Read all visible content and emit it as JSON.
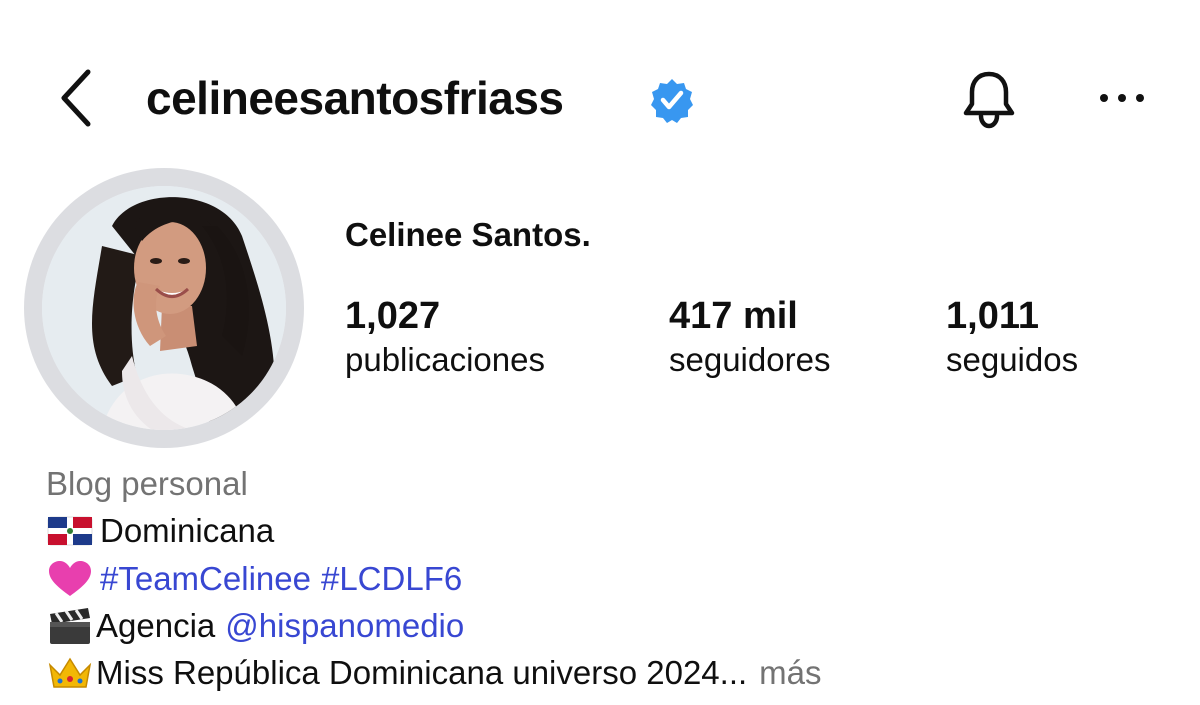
{
  "header": {
    "back_icon": "chevron-left-icon",
    "username": "celineesantosfriass",
    "verified_icon": "verified-badge-icon",
    "verified_color": "#3897f0",
    "bell_icon": "bell-icon",
    "more_icon": "more-horizontal-icon"
  },
  "profile": {
    "avatar_icon": "profile-photo",
    "display_name": "Celinee Santos.",
    "stats": [
      {
        "count": "1,027",
        "label": "publicaciones"
      },
      {
        "count": "417 mil",
        "label": "seguidores"
      },
      {
        "count": "1,011",
        "label": "seguidos"
      }
    ]
  },
  "bio": {
    "category": "Blog personal",
    "line1_emoji": "dominican-flag-icon",
    "line1_text": "Dominicana",
    "line2_emoji": "pink-heart-icon",
    "line2_hashtag1": "#TeamCelinee",
    "line2_hashtag2": "#LCDLF6",
    "line3_emoji": "clapperboard-icon",
    "line3_text": "Agencia",
    "line3_mention": "@hispanomedio",
    "line4_emoji": "crown-icon",
    "line4_text": "Miss República Dominicana universo 2024...",
    "line4_more": "más"
  },
  "colors": {
    "link": "#3847d2",
    "muted": "#737373",
    "avatar_ring": "#dcdde1"
  }
}
